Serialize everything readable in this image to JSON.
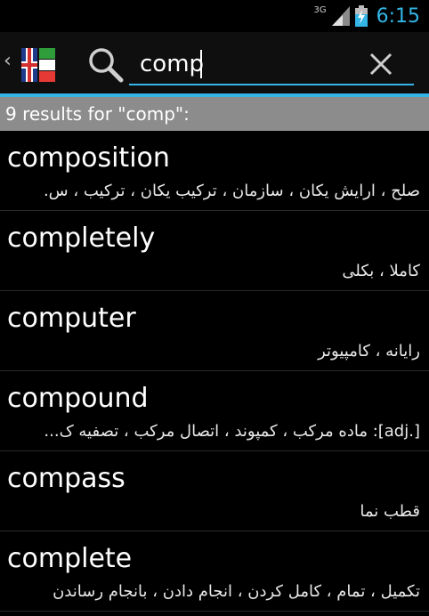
{
  "status_bar": {
    "network_type": "3G",
    "time": "6:15"
  },
  "action_bar": {
    "search": {
      "value": "comp",
      "placeholder": ""
    }
  },
  "results_header": "9 results for \"comp\":",
  "results": [
    {
      "word": "composition",
      "meaning": "صلح ، ارایش یکان ، سازمان ، ترکیب یکان ، ترکیب ، س."
    },
    {
      "word": "completely",
      "meaning": "کاملا ، بکلی"
    },
    {
      "word": "computer",
      "meaning": "رایانه ، کامپیوتر"
    },
    {
      "word": "compound",
      "meaning": "[.adj]: ماده مرکب ، کمپوند ، اتصال مرکب ، تصفیه ک..."
    },
    {
      "word": "compass",
      "meaning": "قطب نما"
    },
    {
      "word": "complete",
      "meaning": "تکمیل ، تمام ، کامل کردن ، انجام دادن ، بانجام رساندن"
    }
  ],
  "colors": {
    "accent": "#33b5e5",
    "header_bg": "#8c8c8c",
    "background": "#000000"
  }
}
